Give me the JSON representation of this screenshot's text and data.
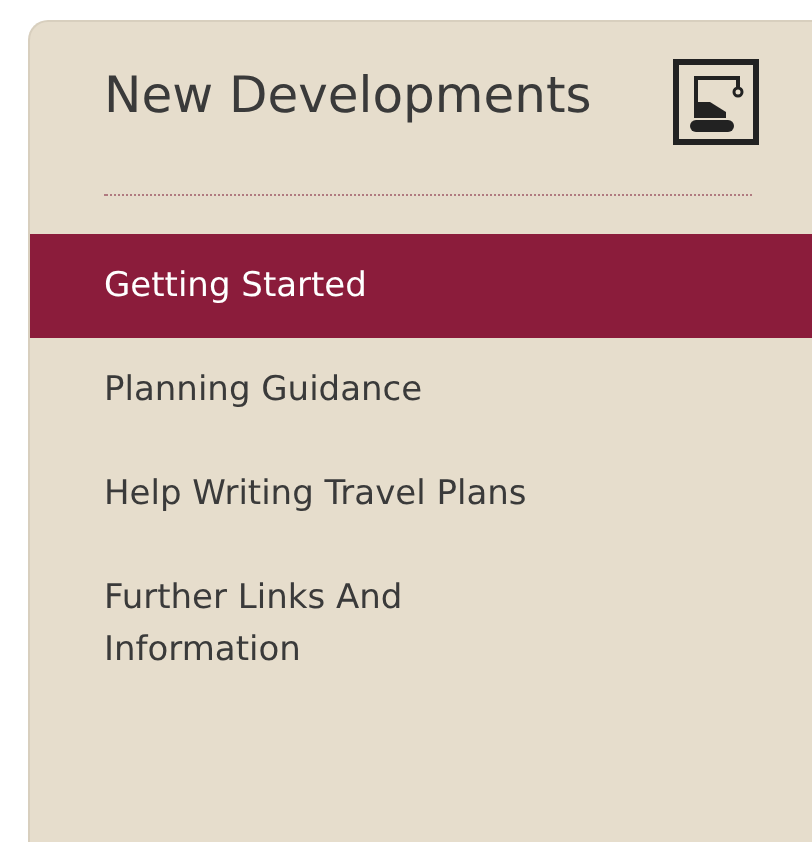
{
  "panel": {
    "title": "New Developments"
  },
  "menu": [
    {
      "label": "Getting Started",
      "selected": true
    },
    {
      "label": "Planning Guidance",
      "selected": false
    },
    {
      "label": "Help Writing Travel Plans",
      "selected": false
    },
    {
      "label": "Further Links And Information",
      "selected": false
    }
  ]
}
